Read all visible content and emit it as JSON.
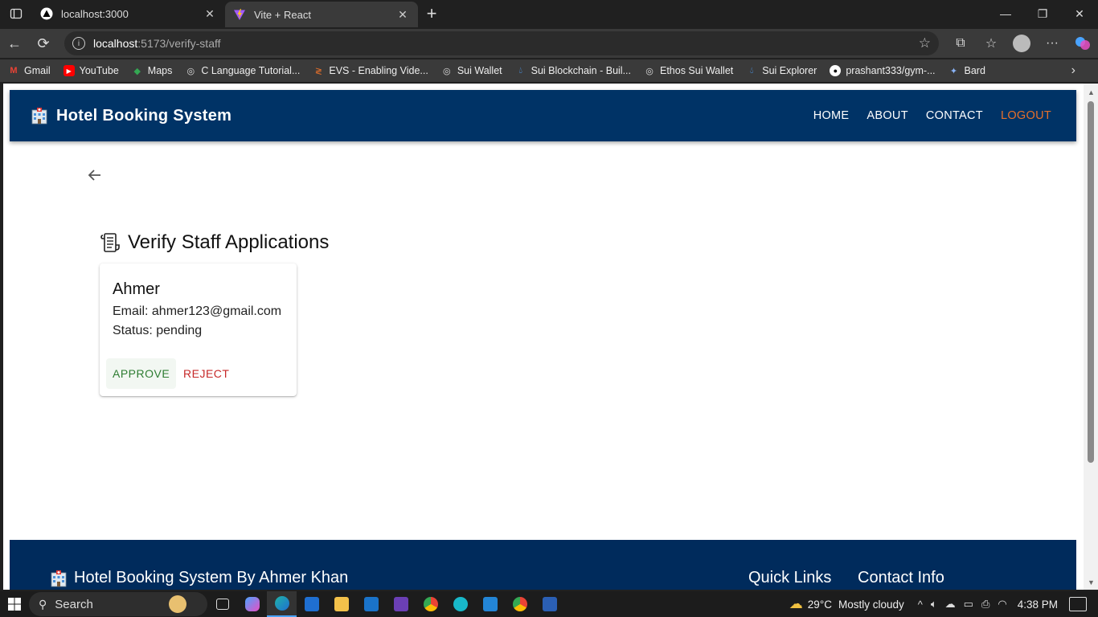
{
  "browser": {
    "tabs": [
      {
        "title": "localhost:3000",
        "active": false
      },
      {
        "title": "Vite + React",
        "active": true
      }
    ],
    "url_host": "localhost",
    "url_path": ":5173/verify-staff",
    "bookmarks": [
      {
        "label": "Gmail",
        "icon": "gmail-icon",
        "color": "#ea4335"
      },
      {
        "label": "YouTube",
        "icon": "youtube-icon",
        "color": "#ff0000"
      },
      {
        "label": "Maps",
        "icon": "maps-icon",
        "color": "#34a853"
      },
      {
        "label": "C Language Tutorial...",
        "icon": "globe-icon",
        "color": "#dddddd"
      },
      {
        "label": "EVS - Enabling Vide...",
        "icon": "evs-icon",
        "color": "#e8702a"
      },
      {
        "label": "Sui Wallet",
        "icon": "globe-icon",
        "color": "#dddddd"
      },
      {
        "label": "Sui Blockchain - Buil...",
        "icon": "sui-drop-icon",
        "color": "#4da2ff"
      },
      {
        "label": "Ethos Sui Wallet",
        "icon": "globe-icon",
        "color": "#dddddd"
      },
      {
        "label": "Sui Explorer",
        "icon": "sui-drop-icon",
        "color": "#4da2ff"
      },
      {
        "label": "prashant333/gym-...",
        "icon": "github-icon",
        "color": "#ffffff"
      },
      {
        "label": "Bard",
        "icon": "bard-sparkle-icon",
        "color": "#8ab4f8"
      }
    ]
  },
  "app": {
    "brand": "Hotel Booking System",
    "nav": {
      "home": "HOME",
      "about": "ABOUT",
      "contact": "CONTACT",
      "logout": "LOGOUT"
    },
    "page_title": "Verify Staff Applications",
    "applications": [
      {
        "name": "Ahmer",
        "email": "Email: ahmer123@gmail.com",
        "status": "Status: pending",
        "approve": "APPROVE",
        "reject": "REJECT"
      }
    ],
    "footer": {
      "brand": "Hotel Booking System By Ahmer Khan",
      "quick_links": "Quick Links",
      "contact_info": "Contact Info"
    },
    "colors": {
      "navbar": "#003366",
      "logout": "#e8702a",
      "approve": "#2e7d32",
      "reject": "#c62828"
    }
  },
  "taskbar": {
    "search": "Search",
    "weather_temp": "29°C",
    "weather_text": "Mostly cloudy",
    "time": "4:38 PM"
  }
}
